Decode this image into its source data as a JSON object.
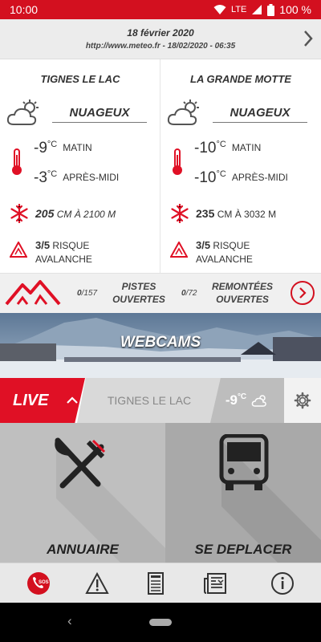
{
  "status": {
    "time": "10:00",
    "network": "LTE",
    "battery": "100 %"
  },
  "header": {
    "date": "18 février 2020",
    "source": "http://www.meteo.fr - 18/02/2020 - 06:35"
  },
  "stations": [
    {
      "name": "TIGNES LE LAC",
      "condition": "NUAGEUX",
      "temp_morning": "-9",
      "temp_afternoon": "-3",
      "unit": "°C",
      "morning_label": "MATIN",
      "afternoon_label": "APRÈS-MIDI",
      "snow_value": "205",
      "snow_text": "CM À 2100 M",
      "risk_value": "3/5",
      "risk_word": "RISQUE",
      "risk_label2": "AVALANCHE"
    },
    {
      "name": "LA GRANDE MOTTE",
      "condition": "NUAGEUX",
      "temp_morning": "-10",
      "temp_afternoon": "-10",
      "unit": "°C",
      "morning_label": "MATIN",
      "afternoon_label": "APRÈS-MIDI",
      "snow_value": "235",
      "snow_text": "CM À 3032 M",
      "risk_value": "3/5",
      "risk_word": "RISQUE",
      "risk_label2": "AVALANCHE"
    }
  ],
  "slopes": {
    "pistes_open": "0",
    "pistes_total": "/157",
    "pistes_label1": "PISTES",
    "pistes_label2": "OUVERTES",
    "lifts_open": "0",
    "lifts_total": "/72",
    "lifts_label1": "REMONTÉES",
    "lifts_label2": "OUVERTES"
  },
  "webcams": {
    "label": "WEBCAMS"
  },
  "live": {
    "label": "LIVE",
    "station": "TIGNES LE LAC",
    "temp": "-9",
    "unit": "°C"
  },
  "tiles": {
    "annuaire": "ANNUAIRE",
    "deplacer": "SE DEPLACER"
  },
  "tabbar": {
    "sos": "SOS"
  },
  "colors": {
    "accent": "#d3101f",
    "live": "#e01025"
  }
}
